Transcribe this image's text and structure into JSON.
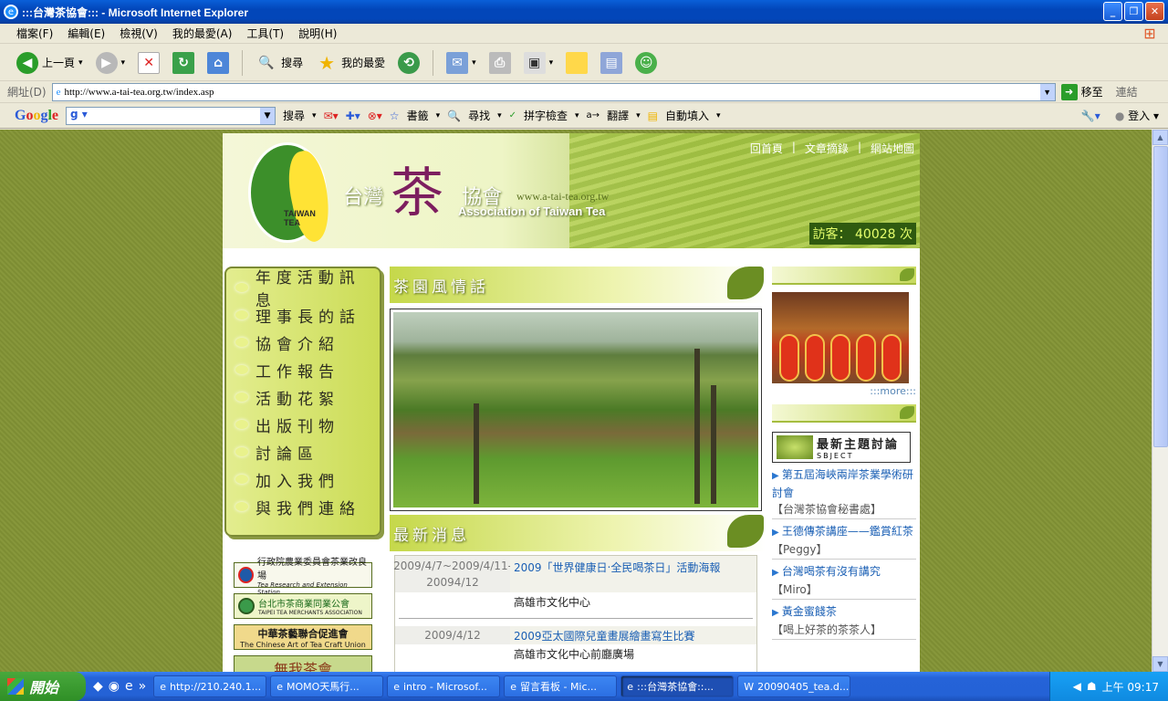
{
  "window": {
    "title": ":::台灣茶協會::: - Microsoft Internet Explorer"
  },
  "menu": [
    "檔案(F)",
    "編輯(E)",
    "檢視(V)",
    "我的最愛(A)",
    "工具(T)",
    "說明(H)"
  ],
  "toolbar": {
    "back": "上一頁",
    "search": "搜尋",
    "favorites": "我的最愛"
  },
  "address": {
    "label": "網址(D)",
    "url": "http://www.a-tai-tea.org.tw/index.asp",
    "go": "移至",
    "links": "連結"
  },
  "google": {
    "logo": "Google",
    "search": "搜尋",
    "bookmarks": "書籤",
    "find": "尋找",
    "spell": "拼字檢查",
    "translate": "翻譯",
    "autofill": "自動填入",
    "signin": "登入"
  },
  "site": {
    "toplinks": [
      "回首頁",
      "文章摘錄",
      "網站地圖"
    ],
    "brand_cn1": "台灣",
    "brand_big": "茶",
    "brand_cn2": "協會",
    "brand_url": "www.a-tai-tea.org.tw",
    "brand_en": "Association of Taiwan Tea",
    "logo_text": "TAIWAN TEA",
    "visitors": "訪客： 40028 次",
    "nav": [
      "年度活動訊息",
      "理事長的話",
      "協會介紹",
      "工作報告",
      "活動花絮",
      "出版刊物",
      "討論區",
      "加入我們",
      "與我們連絡"
    ],
    "scenery_title": "茶園風情話",
    "news_title": "最新消息",
    "news": [
      {
        "date": "2009/4/7~2009/4/11-20094/12",
        "title": "2009「世界健康日‧全民喝茶日」活動海報",
        "location": "高雄市文化中心"
      },
      {
        "date": "2009/4/12",
        "title": "2009亞太國際兒童畫展繪畫寫生比賽",
        "location": "高雄市文化中心前廳廣場"
      }
    ],
    "partners": [
      {
        "name": "行政院農業委員會茶業改良場",
        "en": "Tea Research and Extension Station"
      },
      {
        "name": "台北市茶商業同業公會",
        "en": "TAIPEI TEA MERCHANTS ASSOCIATION"
      },
      {
        "name": "中華茶藝聯合促進會",
        "en": "The Chinese Art of Tea Craft Union"
      },
      {
        "name": "無我茶會",
        "en": ""
      }
    ],
    "more": ":::more:::",
    "discuss_title": "最新主題討論",
    "discuss_sub": "SBJECT",
    "topics": [
      {
        "q": "第五屆海峽兩岸茶業學術研討會",
        "a": "【台灣茶協會秘書處】"
      },
      {
        "q": "王德傳茶講座——鑑賞紅茶",
        "a": "【Peggy】"
      },
      {
        "q": "台灣喝茶有沒有講究",
        "a": "【Miro】"
      },
      {
        "q": "黃金蜜餞茶",
        "a": "【喝上好茶的茶茶人】"
      }
    ]
  },
  "taskbar": {
    "start": "開始",
    "tasks": [
      "http://210.240.1...",
      "MOMO天馬行...",
      "intro - Microsof...",
      "留言看板 - Mic...",
      ":::台灣茶協會::...",
      "20090405_tea.d..."
    ],
    "clock": "上午 09:17"
  }
}
